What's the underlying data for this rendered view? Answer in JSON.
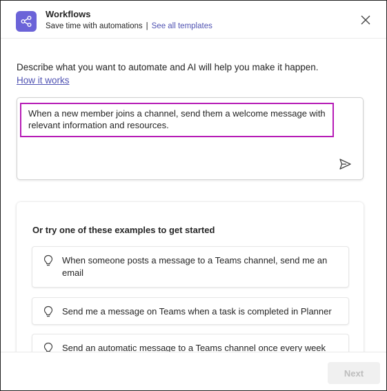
{
  "header": {
    "title": "Workflows",
    "subtitle": "Save time with automations",
    "separator": "|",
    "templates_link": "See all templates"
  },
  "main": {
    "intro": "Describe what you want to automate and AI will help you make it happen.",
    "how_link": "How it works",
    "prompt_value": "When a new member joins a channel, send them a welcome message with relevant information and resources.",
    "examples_title": "Or try one of these examples to get started",
    "examples": [
      {
        "label": "When someone posts a message to a Teams channel, send me an email"
      },
      {
        "label": "Send me a message on Teams when a task is completed in Planner"
      },
      {
        "label": "Send an automatic message to a Teams channel once every week"
      }
    ]
  },
  "footer": {
    "next_label": "Next"
  },
  "colors": {
    "brand": "#6b63d8",
    "link": "#4f52b2",
    "focus_border": "#b61bb6"
  },
  "icons": {
    "app": "workflow-share-icon",
    "close": "close-icon",
    "send": "send-icon",
    "example": "lightbulb-icon"
  }
}
